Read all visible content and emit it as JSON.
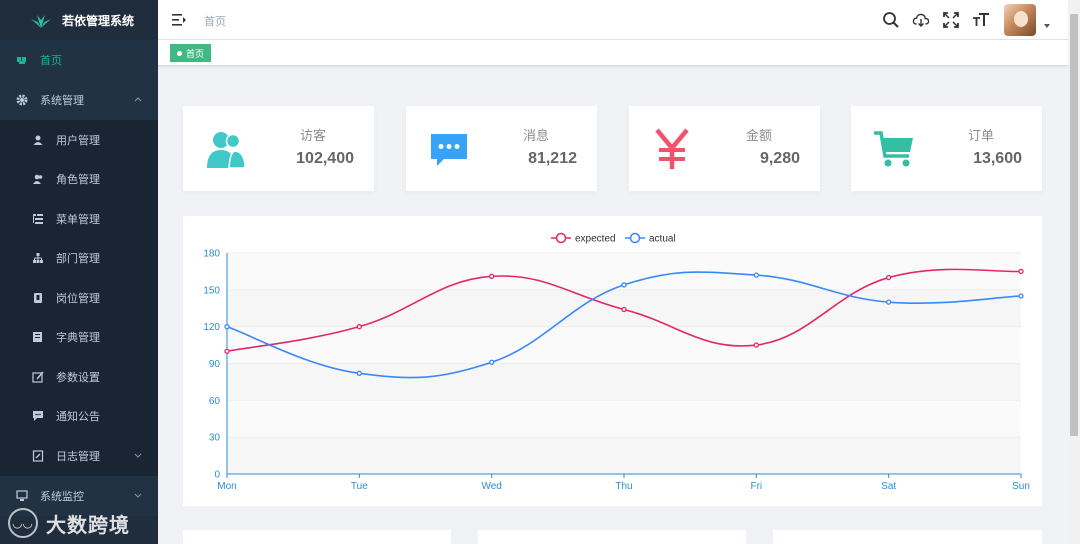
{
  "app": {
    "title": "若依管理系统"
  },
  "sidebar": {
    "items": [
      {
        "label": "首页",
        "icon": "dashboard-icon"
      },
      {
        "label": "系统管理",
        "icon": "gear-icon"
      },
      {
        "label": "用户管理",
        "icon": "user-icon"
      },
      {
        "label": "角色管理",
        "icon": "peoples-icon"
      },
      {
        "label": "菜单管理",
        "icon": "tree-table-icon"
      },
      {
        "label": "部门管理",
        "icon": "tree-icon"
      },
      {
        "label": "岗位管理",
        "icon": "post-icon"
      },
      {
        "label": "字典管理",
        "icon": "dict-icon"
      },
      {
        "label": "参数设置",
        "icon": "edit-icon"
      },
      {
        "label": "通知公告",
        "icon": "message-icon"
      },
      {
        "label": "日志管理",
        "icon": "log-icon"
      },
      {
        "label": "系统监控",
        "icon": "monitor-icon"
      }
    ]
  },
  "header": {
    "breadcrumb": "首页",
    "icons": [
      "search-icon",
      "cloud-download-icon",
      "fullscreen-icon",
      "font-size-icon"
    ]
  },
  "tags": [
    {
      "label": "首页",
      "active": true
    }
  ],
  "watermark": {
    "text": "大数跨境"
  },
  "panels": [
    {
      "label": "访客",
      "value": "102,400",
      "icon": "peoples-icon",
      "color": "#40c9c6"
    },
    {
      "label": "消息",
      "value": "81,212",
      "icon": "message-icon",
      "color": "#36a3f7"
    },
    {
      "label": "金额",
      "value": "9,280",
      "icon": "money-icon",
      "color": "#f4516c"
    },
    {
      "label": "订单",
      "value": "13,600",
      "icon": "shopping-icon",
      "color": "#34bfa3"
    }
  ],
  "chart_data": {
    "type": "line",
    "categories": [
      "Mon",
      "Tue",
      "Wed",
      "Thu",
      "Fri",
      "Sat",
      "Sun"
    ],
    "series": [
      {
        "name": "expected",
        "values": [
          100,
          120,
          161,
          134,
          105,
          160,
          165
        ],
        "color": "#e2276b"
      },
      {
        "name": "actual",
        "values": [
          120,
          82,
          91,
          154,
          162,
          140,
          145
        ],
        "color": "#3888fa"
      }
    ],
    "ylim": [
      0,
      180
    ],
    "yticks": [
      0,
      30,
      60,
      90,
      120,
      150,
      180
    ],
    "legend": "top-center",
    "grid": true
  }
}
